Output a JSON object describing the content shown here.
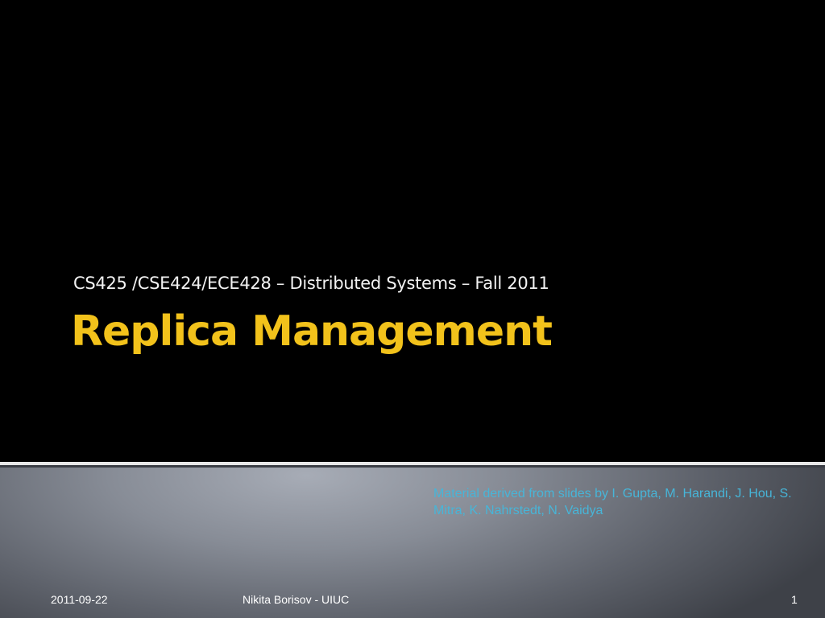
{
  "slide": {
    "subtitle": "CS425 /CSE424/ECE428 – Distributed Systems – Fall 2011",
    "title": "Replica Management",
    "credit": "Material derived from slides by I. Gupta, M. Harandi, J. Hou, S. Mitra, K. Nahrstedt, N. Vaidya"
  },
  "footer": {
    "date": "2011-09-22",
    "author": "Nikita Borisov - UIUC",
    "page_number": "1"
  },
  "colors": {
    "background": "#000000",
    "title": "#f2c21b",
    "subtitle": "#f2f2f2",
    "credit": "#47b5d8",
    "footer": "#ffffff"
  }
}
